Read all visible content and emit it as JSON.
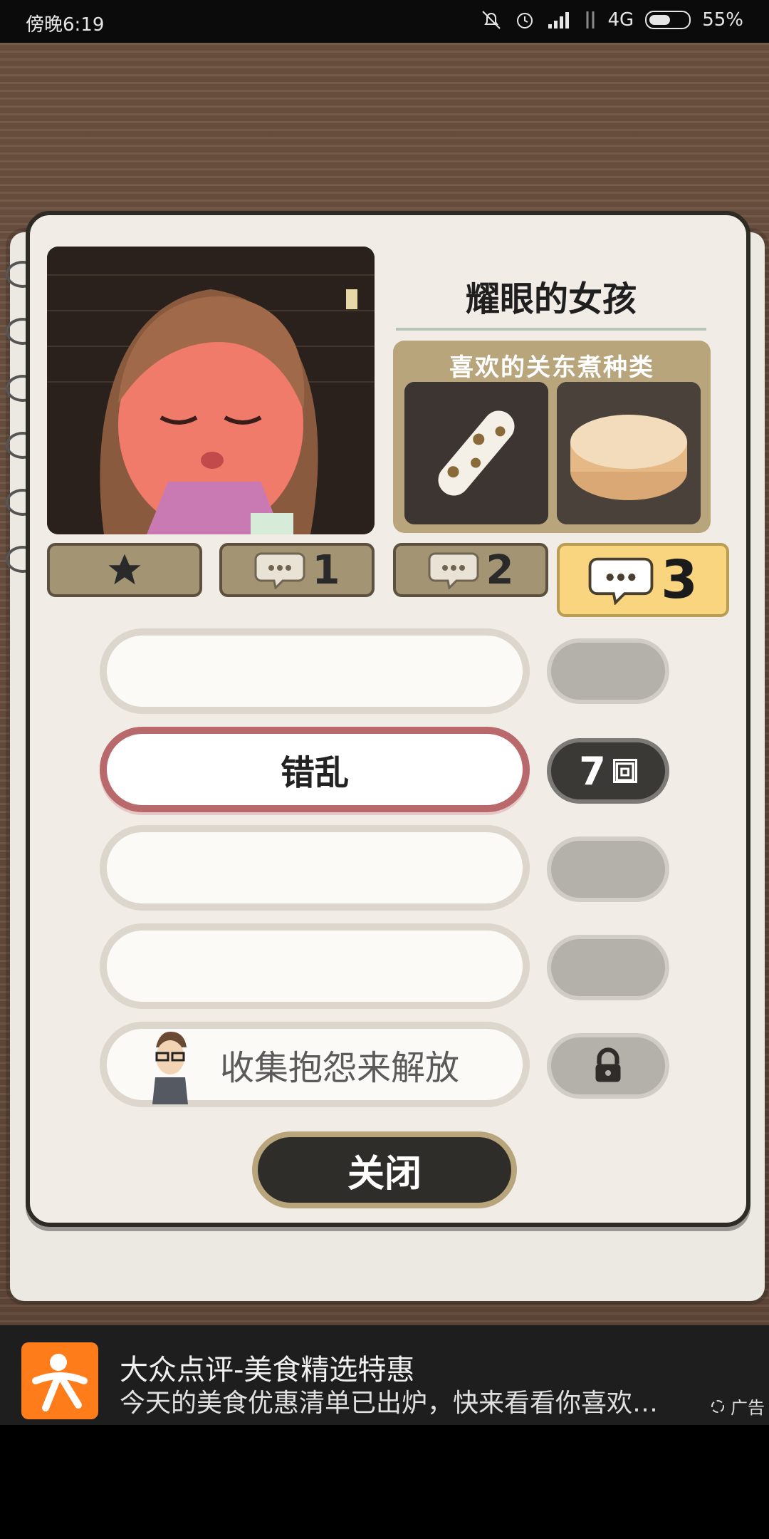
{
  "status_bar": {
    "time": "傍晚6:19",
    "network": "4G",
    "battery": "55%",
    "battery_level": 0.55
  },
  "character": {
    "name": "耀眼的女孩",
    "favorite_title": "喜欢的关东煮种类"
  },
  "tabs": [
    {
      "kind": "star",
      "label": ""
    },
    {
      "kind": "comment",
      "label": "1"
    },
    {
      "kind": "comment",
      "label": "2"
    },
    {
      "kind": "comment",
      "label": "3",
      "active": true
    }
  ],
  "complaints": [
    {
      "label": ""
    },
    {
      "label": "错乱",
      "count": "7",
      "unit": "回"
    },
    {
      "label": ""
    },
    {
      "label": ""
    },
    {
      "label": "收集抱怨来解放"
    }
  ],
  "buttons": {
    "close": "关闭"
  },
  "ad": {
    "title": "大众点评-美食精选特惠",
    "subtitle": "今天的美食优惠清单已出炉，快来看看你喜欢…",
    "tag": "广告"
  },
  "colors": {
    "accent_yellow": "#f8d57e",
    "panel_tan": "#b8a57c",
    "selected_border": "#b9686c",
    "ad_logo": "#ff7c1a"
  }
}
